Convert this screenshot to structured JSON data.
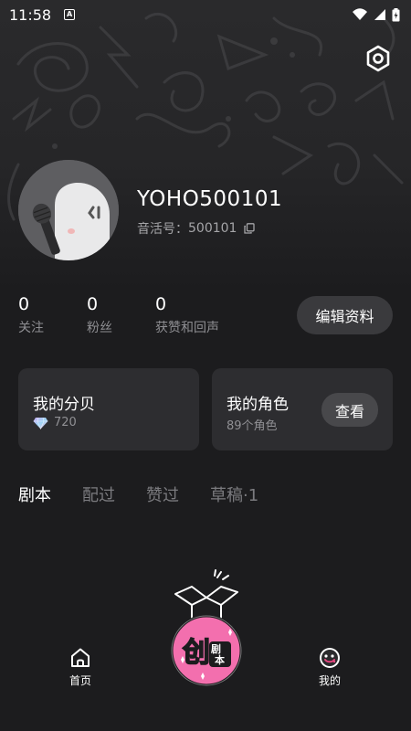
{
  "status_bar": {
    "time": "11:58",
    "notification_letter": "A"
  },
  "profile": {
    "username": "YOHO500101",
    "id_label": "音活号：",
    "id_value": "500101"
  },
  "stats": [
    {
      "count": "0",
      "label": "关注"
    },
    {
      "count": "0",
      "label": "粉丝"
    },
    {
      "count": "0",
      "label": "获赞和回声"
    }
  ],
  "edit_button": "编辑资料",
  "cards": {
    "decibels": {
      "title": "我的分贝",
      "value": "720",
      "icon": "gem-icon"
    },
    "characters": {
      "title": "我的角色",
      "subtitle": "89个角色",
      "button": "查看"
    }
  },
  "tabs": [
    "剧本",
    "配过",
    "赞过",
    "草稿·1"
  ],
  "active_tab": "剧本",
  "bottom_nav": {
    "home": {
      "label": "首页",
      "icon": "home-icon"
    },
    "create": {
      "text_big": "创",
      "text_small": "剧本",
      "icon": "create-script-icon"
    },
    "me": {
      "label": "我的",
      "icon": "smiley-icon"
    }
  },
  "colors": {
    "background": "#1c1c1e",
    "card": "#2d2d30",
    "accent_pink": "#f36fae"
  }
}
